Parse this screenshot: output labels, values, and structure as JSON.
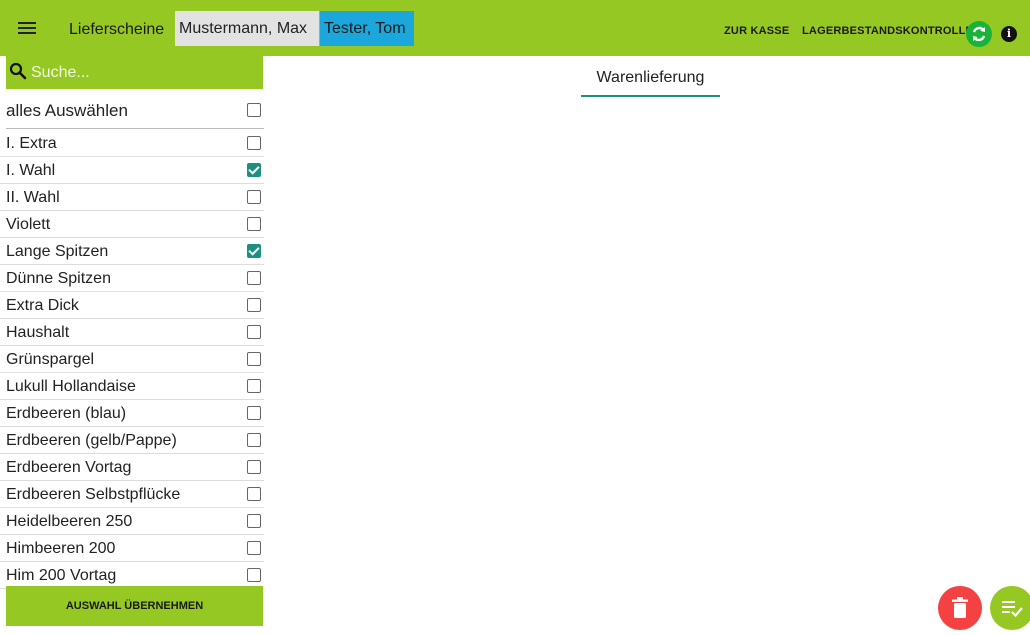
{
  "header": {
    "menu_icon": "hamburger-menu-icon",
    "title": "Lieferscheine",
    "users": [
      "Mustermann, Max",
      "Tester, Tom"
    ],
    "link_kasse": "ZUR KASSE",
    "link_lager": "LAGERBESTANDSKONTROLLE",
    "refresh_icon": "refresh-icon",
    "info_icon": "info-icon",
    "colors": {
      "bar": "#95c823",
      "chip_active": "#1ba7dc",
      "chip_inactive": "#e2e2e2"
    }
  },
  "sidebar": {
    "search_icon": "search-icon",
    "search_placeholder": "Suche...",
    "search_value": "",
    "select_all_label": "alles Auswählen",
    "select_all_checked": false,
    "items": [
      {
        "label": "I. Extra",
        "checked": false
      },
      {
        "label": "I. Wahl",
        "checked": true
      },
      {
        "label": "II. Wahl",
        "checked": false
      },
      {
        "label": "Violett",
        "checked": false
      },
      {
        "label": "Lange Spitzen",
        "checked": true
      },
      {
        "label": "Dünne Spitzen",
        "checked": false
      },
      {
        "label": "Extra Dick",
        "checked": false
      },
      {
        "label": "Haushalt",
        "checked": false
      },
      {
        "label": "Grünspargel",
        "checked": false
      },
      {
        "label": "Lukull Hollandaise",
        "checked": false
      },
      {
        "label": "Erdbeeren (blau)",
        "checked": false
      },
      {
        "label": "Erdbeeren (gelb/Pappe)",
        "checked": false
      },
      {
        "label": "Erdbeeren Vortag",
        "checked": false
      },
      {
        "label": "Erdbeeren Selbstpflücke",
        "checked": false
      },
      {
        "label": "Heidelbeeren 250",
        "checked": false
      },
      {
        "label": "Himbeeren 200",
        "checked": false
      },
      {
        "label": "Him 200 Vortag",
        "checked": false
      }
    ],
    "apply_label": "AUSWAHL ÜBERNEHMEN"
  },
  "main": {
    "tab_label": "Warenlieferung",
    "accent": "#1d8f80",
    "fab_delete_icon": "trash-icon",
    "fab_delete_color": "#f44242",
    "fab_confirm_icon": "playlist-check-icon",
    "fab_confirm_color": "#95c823"
  }
}
